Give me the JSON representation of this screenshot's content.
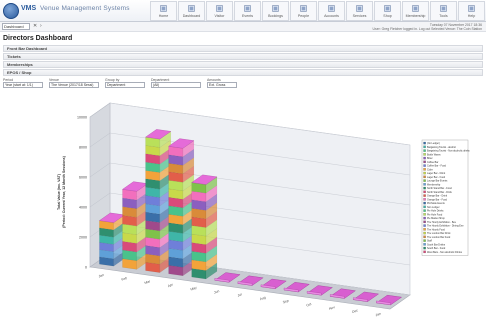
{
  "app": {
    "logo": "VMS",
    "brand": "Venue Management Systems"
  },
  "nav": [
    {
      "label": "Home",
      "icon": "home-icon"
    },
    {
      "label": "Dashboard",
      "icon": "dashboard-icon"
    },
    {
      "label": "Visitor",
      "icon": "pencil-icon"
    },
    {
      "label": "Events",
      "icon": "calendar-icon"
    },
    {
      "label": "Bookings",
      "icon": "booking-icon"
    },
    {
      "label": "People",
      "icon": "person-icon"
    },
    {
      "label": "Accounts",
      "icon": "accounts-icon"
    },
    {
      "label": "Services",
      "icon": "tag-icon"
    },
    {
      "label": "Shop",
      "icon": "bag-icon"
    },
    {
      "label": "Membership",
      "icon": "membership-icon"
    },
    {
      "label": "Tools",
      "icon": "tools-icon"
    },
    {
      "label": "Help",
      "icon": "help-icon"
    }
  ],
  "subbar": {
    "dashboard_select": "Dashboard",
    "status_line1": "Tuesday 07 November 2017 18:36",
    "status_line2": "User: Greg Fletcher logged in. Log out  Selected Venue: The Coin Station"
  },
  "page_title": "Directors Dashboard",
  "panels": [
    "Front Bar Dashboard",
    "Tickets",
    "Memberships",
    "EPOS / Shop"
  ],
  "filters": [
    {
      "label": "Period",
      "value": "Year (start at: 1/1)"
    },
    {
      "label": "Venue",
      "value": "The Venue (2017/18 Sessi)"
    },
    {
      "label": "Group by",
      "value": "Department"
    },
    {
      "label": "Department",
      "value": "(All)"
    },
    {
      "label": "Amounts",
      "value": "Ext. Gross"
    }
  ],
  "chart_data": {
    "type": "bar",
    "stacked": true,
    "three_d": true,
    "ylabel": "Total Value (inc. VAT)\n(Period: Current Year, 12 Month Sessions)",
    "yticks": [
      "0",
      "2000",
      "4000",
      "6000",
      "8000",
      "10000"
    ],
    "ylim": [
      0,
      10000
    ],
    "categories": [
      "Jan",
      "Feb",
      "Mar",
      "Apr",
      "May",
      "Jun",
      "Jul",
      "Aug",
      "Sep",
      "Oct",
      "Nov",
      "Dec",
      "Jan"
    ],
    "totals": [
      2900,
      5200,
      8900,
      8500,
      6300,
      0,
      250,
      250,
      250,
      250,
      250,
      250,
      250
    ],
    "legend": [
      "(No Ledger)",
      "Bargaining Tourist - alcohol",
      "Bargaining Tourist - Non alcoholic drinks",
      "Bottle Wares",
      "Bitter",
      "Coffee Bar",
      "Coffee Bar - Food",
      "Cider",
      "Lager Bar - Drink",
      "Lager Bar - Food",
      "Lounge Bar Events",
      "Membership",
      "North Stand Bar - Food",
      "North Stand Bar - Drink",
      "Orange Bar - Drink",
      "Orange Bar - Food",
      "Pitchside Events",
      "Non Lodger",
      "Pie Hole Drinks",
      "Pie Hole Food",
      "Pie Market Shop",
      "The Hourly Exhibition - Bev",
      "The Hourly Exhibition - Dining Ene",
      "The Hourly Food",
      "The London Bar Drink",
      "The London Bar Food",
      "Staff",
      "South Bar Drinks",
      "South Bar - Food",
      "West Bars - Non alcoholic Drinks"
    ]
  }
}
